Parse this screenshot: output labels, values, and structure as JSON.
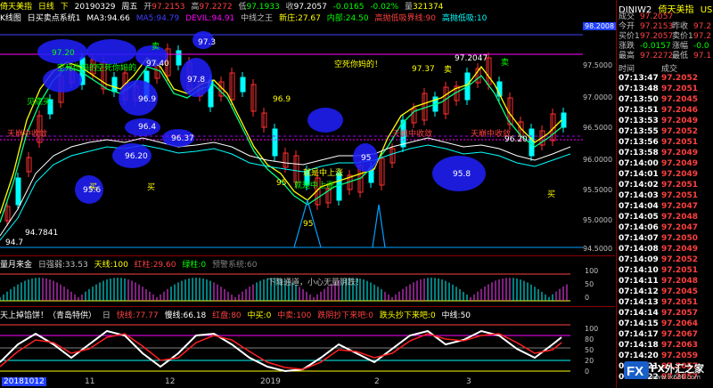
{
  "topbar": {
    "title": "倚天美指",
    "period": "日线",
    "nav": "下",
    "date": "20190329",
    "weekday": "周五",
    "open_label": "开",
    "open": "97.2153",
    "high_label": "高",
    "high": "97.2272",
    "low_label": "低",
    "low": "97.1933",
    "close_label": "收",
    "close": "97.2057",
    "change": "-0.0165",
    "change_pct": "-0.02%",
    "volume_label": "量",
    "volume": "321374"
  },
  "indicator_line": {
    "k_label": "K线图",
    "sys1": "日买卖点系统1",
    "ma3": "MA3:94.66",
    "ma5": "MA5:94.79",
    "devil": "DEVIL:94.91",
    "zhongxian": "中线之王",
    "xinzhu": "新庄:27.67",
    "neibu": "内部:24.50",
    "highlow": "高抛低吸界线:90",
    "extra": "高抛低吸:10"
  },
  "main_chart": {
    "price_ticks": [
      "98.2008",
      "97.5000",
      "97.0000",
      "96.5000",
      "96.0000",
      "95.5000",
      "95.0000",
      "94.5000"
    ],
    "price_labels": [
      "97.20",
      "97.40",
      "97.3",
      "96.9",
      "97.8",
      "96.4",
      "96.37",
      "96.20",
      "95.6",
      "94.7841",
      "94.7",
      "96.9",
      "97.37",
      "97.2047",
      "96.20",
      "95.8",
      "95",
      "95",
      "95"
    ],
    "annotations": [
      "空死你妈的！",
      "空死你妈的",
      "见底买",
      "空死你妈的",
      "卖",
      "买",
      "天崩中收敛",
      "天崩中收敛",
      "天崩中收敛",
      "就是中上涨",
      "就是中上涨",
      "买",
      "买",
      "卖",
      "卖"
    ]
  },
  "panel2": {
    "title": "量月来金",
    "a": "日强弱:33.53",
    "b": "天线:100",
    "c": "红柱:29.60",
    "d": "绿柱:0",
    "e": "预警系统:60",
    "note": "下降通道，小心无量阴跌！",
    "ticks": [
      "100",
      "50",
      "0"
    ]
  },
  "panel3": {
    "title": "天上掉馅饼！（青岛特供）",
    "a": "日",
    "b": "快线:77.77",
    "c": "慢线:66.18",
    "d": "红盘:80",
    "e": "中买:0",
    "f": "中卖:100",
    "g": "跌阴抄下来吧:0",
    "h": "跌头抄下来吧:0",
    "i": "中线:50",
    "ticks": [
      "100",
      "80",
      "50",
      "20",
      "0"
    ]
  },
  "xaxis": {
    "labels": [
      "20181012",
      "11",
      "12",
      "2019",
      "2",
      "3"
    ]
  },
  "quote_panel": {
    "code": "DINIW2",
    "name": "倚天美指",
    "suffix": "USA",
    "rows": [
      {
        "l": "成交",
        "v": "97.2057",
        "l2": "",
        "v2": ""
      },
      {
        "l": "今开",
        "v": "97.2153",
        "l2": "昨收",
        "v2": "97.2"
      },
      {
        "l": "买价1",
        "v": "97.2057",
        "l2": "卖价1",
        "v2": "97.2"
      },
      {
        "l": "涨跌",
        "v": "-0.0157",
        "l2": "涨幅",
        "v2": "-0.0"
      },
      {
        "l": "最高",
        "v": "97.2272",
        "l2": "最低",
        "v2": "97.1"
      }
    ],
    "time_header": "时间",
    "price_header": "成交",
    "ticks": [
      {
        "t": "07:13:47",
        "p": "97.2052"
      },
      {
        "t": "07:13:48",
        "p": "97.2051"
      },
      {
        "t": "07:13:50",
        "p": "97.2045"
      },
      {
        "t": "07:13:51",
        "p": "97.2046"
      },
      {
        "t": "07:13:53",
        "p": "97.2049"
      },
      {
        "t": "07:13:55",
        "p": "97.2052"
      },
      {
        "t": "07:13:56",
        "p": "97.2051"
      },
      {
        "t": "07:13:58",
        "p": "97.2049"
      },
      {
        "t": "07:14:00",
        "p": "97.2049"
      },
      {
        "t": "07:14:01",
        "p": "97.2049"
      },
      {
        "t": "07:14:02",
        "p": "97.2051"
      },
      {
        "t": "07:14:03",
        "p": "97.2051"
      },
      {
        "t": "07:14:04",
        "p": "97.2047"
      },
      {
        "t": "07:14:05",
        "p": "97.2048"
      },
      {
        "t": "07:14:06",
        "p": "97.2047"
      },
      {
        "t": "07:14:07",
        "p": "97.2050"
      },
      {
        "t": "07:14:08",
        "p": "97.2049"
      },
      {
        "t": "07:14:09",
        "p": "97.2052"
      },
      {
        "t": "07:14:10",
        "p": "97.2051"
      },
      {
        "t": "07:14:11",
        "p": "97.2048"
      },
      {
        "t": "07:14:12",
        "p": "97.2045"
      },
      {
        "t": "07:14:13",
        "p": "97.2051"
      },
      {
        "t": "07:14:14",
        "p": "97.2057"
      },
      {
        "t": "07:14:15",
        "p": "97.2064"
      },
      {
        "t": "07:14:17",
        "p": "97.2067"
      },
      {
        "t": "07:14:18",
        "p": "97.2063"
      },
      {
        "t": "07:14:20",
        "p": "97.2059"
      },
      {
        "t": "07:14:21",
        "p": "97.2057"
      },
      {
        "t": "07:14:22",
        "p": "97.2057"
      }
    ]
  },
  "watermark": {
    "text": "FX外汇之家",
    "url": "www.fx686.com"
  }
}
